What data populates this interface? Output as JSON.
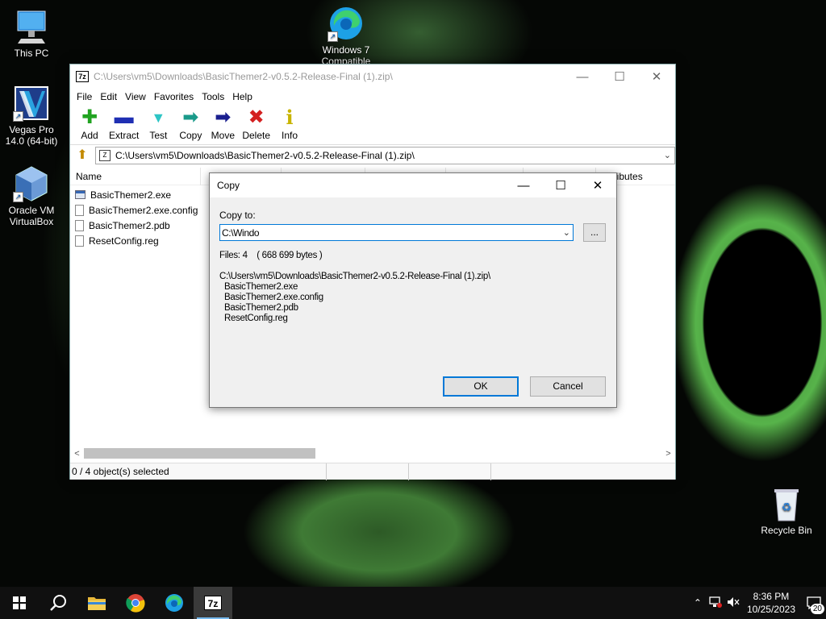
{
  "desktop": {
    "icons": [
      {
        "label": "This PC",
        "icon": "this-pc-icon"
      },
      {
        "label": "Vegas Pro\n14.0 (64-bit)",
        "icon": "vegas-pro-icon"
      },
      {
        "label": "Oracle VM\nVirtualBox",
        "icon": "virtualbox-icon"
      },
      {
        "label": "Windows 7\nCompatible",
        "icon": "edge-icon"
      },
      {
        "label": "Recycle Bin",
        "icon": "recycle-bin-icon"
      }
    ]
  },
  "main_window": {
    "title": "C:\\Users\\vm5\\Downloads\\BasicThemer2-v0.5.2-Release-Final (1).zip\\",
    "menu": [
      "File",
      "Edit",
      "View",
      "Favorites",
      "Tools",
      "Help"
    ],
    "toolbar": [
      {
        "label": "Add",
        "icon": "add-icon",
        "glyph": "✚",
        "color": "#21a321"
      },
      {
        "label": "Extract",
        "icon": "extract-icon",
        "glyph": "▬",
        "color": "#1f2fb3"
      },
      {
        "label": "Test",
        "icon": "test-icon",
        "glyph": "▼",
        "color": "#2dc5c5"
      },
      {
        "label": "Copy",
        "icon": "copy-icon",
        "glyph": "➡",
        "color": "#1a9a8a"
      },
      {
        "label": "Move",
        "icon": "move-icon",
        "glyph": "➡",
        "color": "#1a1f8f"
      },
      {
        "label": "Delete",
        "icon": "delete-icon",
        "glyph": "✖",
        "color": "#d42020"
      },
      {
        "label": "Info",
        "icon": "info-icon",
        "glyph": "i",
        "color": "#c8b400"
      }
    ],
    "address": "C:\\Users\\vm5\\Downloads\\BasicThemer2-v0.5.2-Release-Final (1).zip\\",
    "columns": [
      "Name",
      "Attributes"
    ],
    "files": [
      {
        "name": "BasicThemer2.exe",
        "type": "exe"
      },
      {
        "name": "BasicThemer2.exe.config",
        "type": "file"
      },
      {
        "name": "BasicThemer2.pdb",
        "type": "file"
      },
      {
        "name": "ResetConfig.reg",
        "type": "file"
      }
    ],
    "status": "0 / 4 object(s) selected"
  },
  "copy_dialog": {
    "title": "Copy",
    "copy_to_label": "Copy to:",
    "path_value": "C:\\Windo",
    "browse_label": "...",
    "files_info": "Files: 4    ( 668 699 bytes )",
    "source_path": "C:\\Users\\vm5\\Downloads\\BasicThemer2-v0.5.2-Release-Final (1).zip\\",
    "items": [
      "BasicThemer2.exe",
      "BasicThemer2.exe.config",
      "BasicThemer2.pdb",
      "ResetConfig.reg"
    ],
    "ok_label": "OK",
    "cancel_label": "Cancel"
  },
  "taskbar": {
    "apps": [
      "start-icon",
      "search-icon",
      "file-explorer-icon",
      "chrome-icon",
      "edge-icon",
      "7zip-icon"
    ],
    "time": "8:36 PM",
    "date": "10/25/2023",
    "notification_count": "20",
    "accent": "#76b9ed"
  }
}
